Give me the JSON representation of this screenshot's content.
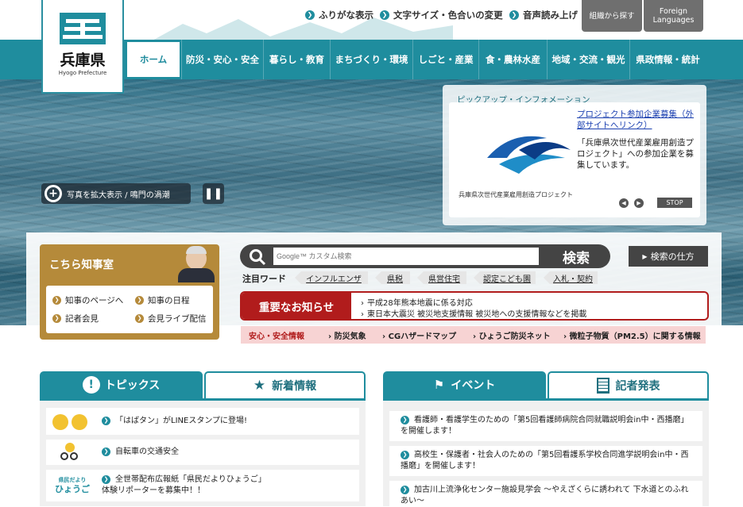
{
  "header": {
    "logo_text": "兵庫県",
    "logo_sub": "Hyogo Prefecture",
    "top_links": [
      {
        "label": "ふりがな表示"
      },
      {
        "label": "文字サイズ・色合いの変更"
      },
      {
        "label": "音声読み上げ"
      }
    ],
    "org_button": "組織から探す",
    "lang_button_1": "Foreign",
    "lang_button_2": "Languages"
  },
  "nav": {
    "items": [
      {
        "label": "ホーム"
      },
      {
        "label": "防災・安心・安全"
      },
      {
        "label": "暮らし・教育"
      },
      {
        "label": "まちづくり・環境"
      },
      {
        "label": "しごと・産業"
      },
      {
        "label": "食・農林水産"
      },
      {
        "label": "地域・交流・観光"
      },
      {
        "label": "県政情報・統計"
      }
    ]
  },
  "hero": {
    "zoom_label": "写真を拡大表示 / 鳴門の渦潮",
    "pause_icon": "pause-icon"
  },
  "pickup": {
    "title": "ピックアップ・インフォメーション",
    "link_text": "プロジェクト参加企業募集（外部サイトへリンク）",
    "description": "「兵庫県次世代産業雇用創造プロジェクト」への参加企業を募集しています。",
    "image_caption": "兵庫県次世代産業雇用創造プロジェクト",
    "stop_label": "STOP"
  },
  "governor": {
    "title": "こちら知事室",
    "links": [
      {
        "label": "知事のページへ"
      },
      {
        "label": "知事の日程"
      },
      {
        "label": "記者会見"
      },
      {
        "label": "会見ライブ配信"
      }
    ]
  },
  "search": {
    "placeholder": "Google™ カスタム検索",
    "button": "検索",
    "how_label": "検索の仕方"
  },
  "keywords": {
    "label": "注目ワード",
    "items": [
      {
        "label": "インフルエンザ"
      },
      {
        "label": "県税"
      },
      {
        "label": "県営住宅"
      },
      {
        "label": "認定こども園"
      },
      {
        "label": "入札・契約"
      }
    ]
  },
  "notice": {
    "label": "重要なお知らせ",
    "items": [
      {
        "label": "平成28年熊本地震に係る対応"
      },
      {
        "label": "東日本大震災 被災地支援情報 被災地への支援情報などを掲載"
      }
    ]
  },
  "safety": {
    "label": "安心・安全情報",
    "items": [
      {
        "label": "防災気象"
      },
      {
        "label": "CGハザードマップ"
      },
      {
        "label": "ひょうご防災ネット"
      },
      {
        "label": "微粒子物質（PM2.5）に関する情報"
      }
    ]
  },
  "left_tabs": {
    "tab1": "トピックス",
    "tab2": "新着情報",
    "items": [
      {
        "label": "「はばタン」がLINEスタンプに登場!"
      },
      {
        "label": "自転車の交通安全"
      },
      {
        "label": "全世帯配布広報紙「県民だよりひょうご」体験リポーターを募集中！！"
      }
    ],
    "thumb3_top": "県民だより",
    "thumb3_bottom": "ひょうご"
  },
  "right_tabs": {
    "tab1": "イベント",
    "tab2": "記者発表",
    "items": [
      {
        "label": "看護師・看護学生のための「第5回看護師病院合同就職説明会in中・西播磨」を開催します！"
      },
      {
        "label": "高校生・保護者・社会人のための「第5回看護系学校合同進学説明会in中・西播磨」を開催します！"
      },
      {
        "label": "加古川上流浄化センター施設見学会 ～やえざくらに誘われて 下水道とのふれあい～"
      }
    ]
  },
  "colors": {
    "brand": "#1f8d9e",
    "governor": "#b58a3a",
    "notice": "#b11c1c"
  }
}
